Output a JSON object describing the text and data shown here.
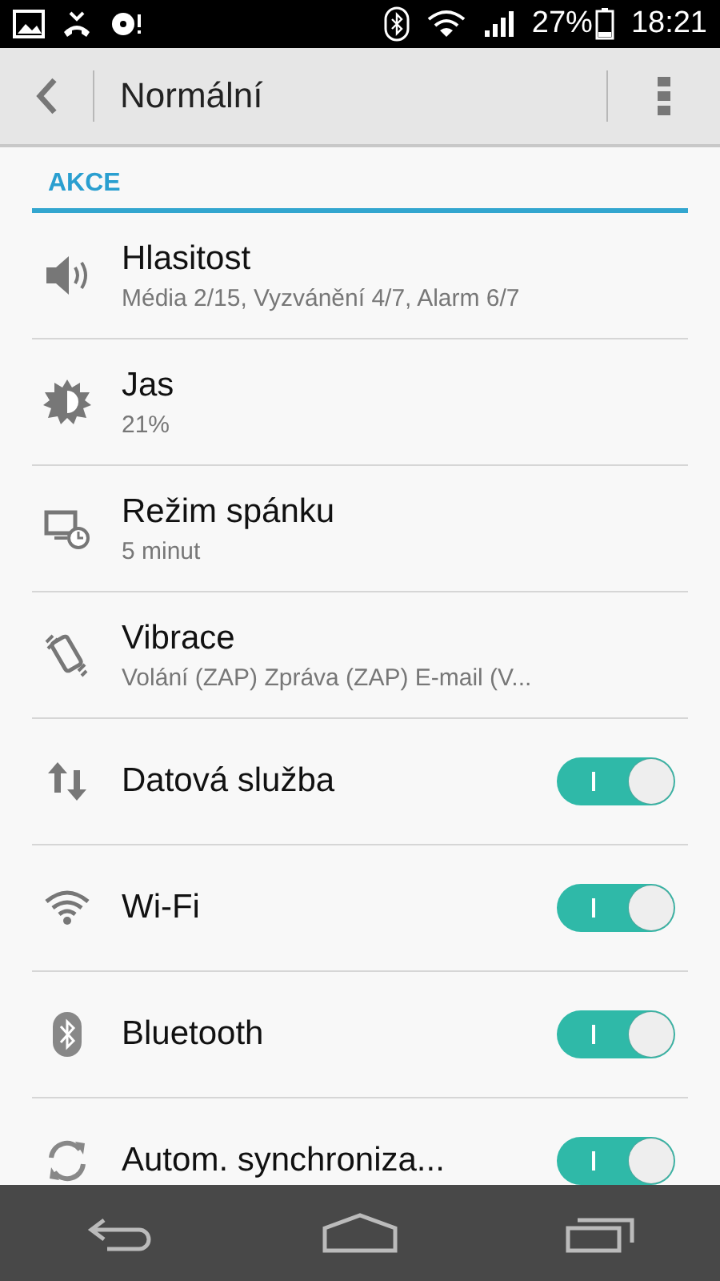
{
  "status_bar": {
    "battery": "27%",
    "time": "18:21"
  },
  "app_bar": {
    "title": "Normální"
  },
  "section": {
    "title": "AKCE"
  },
  "items": [
    {
      "kind": "detail",
      "title": "Hlasitost",
      "subtitle": "Média 2/15, Vyzvánění 4/7, Alarm 6/7"
    },
    {
      "kind": "detail",
      "title": "Jas",
      "subtitle": "21%"
    },
    {
      "kind": "detail",
      "title": "Režim spánku",
      "subtitle": "5 minut"
    },
    {
      "kind": "detail",
      "title": "Vibrace",
      "subtitle": "Volání (ZAP) Zpráva (ZAP) E-mail (V..."
    },
    {
      "kind": "toggle",
      "title": "Datová služba",
      "on": true
    },
    {
      "kind": "toggle",
      "title": "Wi-Fi",
      "on": true
    },
    {
      "kind": "toggle",
      "title": "Bluetooth",
      "on": true
    },
    {
      "kind": "toggle",
      "title": "Autom. synchroniza...",
      "on": true
    }
  ]
}
